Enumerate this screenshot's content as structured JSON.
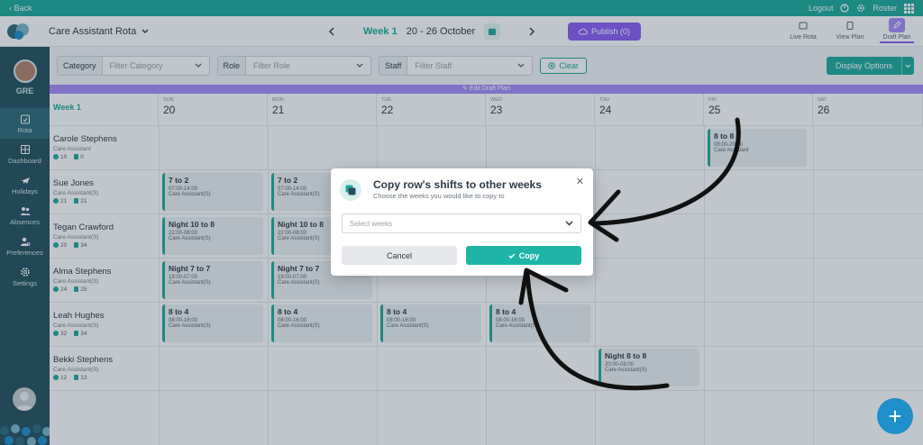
{
  "topbar": {
    "back": "‹ Back",
    "logout": "Logout",
    "roster": "Roster"
  },
  "header": {
    "title": "Care Assistant Rota",
    "week_label": "Week 1",
    "date_range": "20 - 26 October",
    "publish": "Publish (0)",
    "modes": [
      "Live Rota",
      "View Plan",
      "Draft Plan"
    ]
  },
  "sidebar": {
    "initials": "GRE",
    "items": [
      "Rota",
      "Dashboard",
      "Holidays",
      "Absences",
      "Preferences",
      "Settings"
    ]
  },
  "filters": {
    "category_label": "Category",
    "category_placeholder": "Filter Category",
    "role_label": "Role",
    "role_placeholder": "Filter Role",
    "staff_label": "Staff",
    "staff_placeholder": "Filter Staff",
    "clear": "Clear",
    "display_options": "Display Options"
  },
  "draft_banner": "Edit Draft Plan",
  "grid": {
    "week_label": "Week 1",
    "days": [
      {
        "dow": "SUN",
        "num": "20"
      },
      {
        "dow": "MON",
        "num": "21"
      },
      {
        "dow": "TUE",
        "num": "22"
      },
      {
        "dow": "WED",
        "num": "23"
      },
      {
        "dow": "THU",
        "num": "24"
      },
      {
        "dow": "FRI",
        "num": "25"
      },
      {
        "dow": "SAT",
        "num": "26"
      }
    ],
    "staff": [
      {
        "name": "Carole Stephens",
        "role": "Care Assistant",
        "hours": "10",
        "shifts": "0"
      },
      {
        "name": "Sue Jones",
        "role": "Care Assistant(S)",
        "hours": "21",
        "shifts": "21"
      },
      {
        "name": "Tegan Crawford",
        "role": "Care Assistant(S)",
        "hours": "20",
        "shifts": "34"
      },
      {
        "name": "Alma Stephens",
        "role": "Care Assistant(S)",
        "hours": "24",
        "shifts": "25"
      },
      {
        "name": "Leah Hughes",
        "role": "Care Assistant(S)",
        "hours": "32",
        "shifts": "34"
      },
      {
        "name": "Bekki Stephens",
        "role": "Care Assistant(S)",
        "hours": "12",
        "shifts": "13"
      }
    ],
    "shifts": {
      "s_carole_fri": {
        "title": "8 to 8",
        "time": "08:00-20:00",
        "role": "Care Assistant"
      },
      "s_sue_sun": {
        "title": "7 to 2",
        "time": "07:00-14:00",
        "role": "Care Assistant(S)"
      },
      "s_sue_mon": {
        "title": "7 to 2",
        "time": "07:00-14:00",
        "role": "Care Assistant(S)"
      },
      "s_tegan_sun": {
        "title": "Night 10 to 8",
        "time": "22:00-08:00",
        "role": "Care Assistant(S)"
      },
      "s_tegan_mon": {
        "title": "Night 10 to 8",
        "time": "22:00-08:00",
        "role": "Care Assistant(S)"
      },
      "s_alma_sun": {
        "title": "Night 7 to 7",
        "time": "19:00-07:00",
        "role": "Care Assistant(S)"
      },
      "s_alma_mon": {
        "title": "Night 7 to 7",
        "time": "19:00-07:00",
        "role": "Care Assistant(S)"
      },
      "s_leah_sun": {
        "title": "8 to 4",
        "time": "08:00-16:00",
        "role": "Care Assistant(S)"
      },
      "s_leah_mon": {
        "title": "8 to 4",
        "time": "08:00-16:00",
        "role": "Care Assistant(S)"
      },
      "s_leah_tue": {
        "title": "8 to 4",
        "time": "08:00-16:00",
        "role": "Care Assistant(S)"
      },
      "s_leah_wed": {
        "title": "8 to 4",
        "time": "08:00-16:00",
        "role": "Care Assistant(S)"
      },
      "s_bekki_thu": {
        "title": "Night 8 to 8",
        "time": "20:00-08:00",
        "role": "Care Assistant(S)"
      }
    }
  },
  "modal": {
    "title": "Copy row's shifts to other weeks",
    "subtitle": "Choose the weeks you would like to copy to",
    "select_placeholder": "Select weeks",
    "cancel": "Cancel",
    "copy": "Copy"
  },
  "colors": {
    "teal": "#1fa99b",
    "purple": "#8b5cf6",
    "sidebar": "#24505e"
  }
}
